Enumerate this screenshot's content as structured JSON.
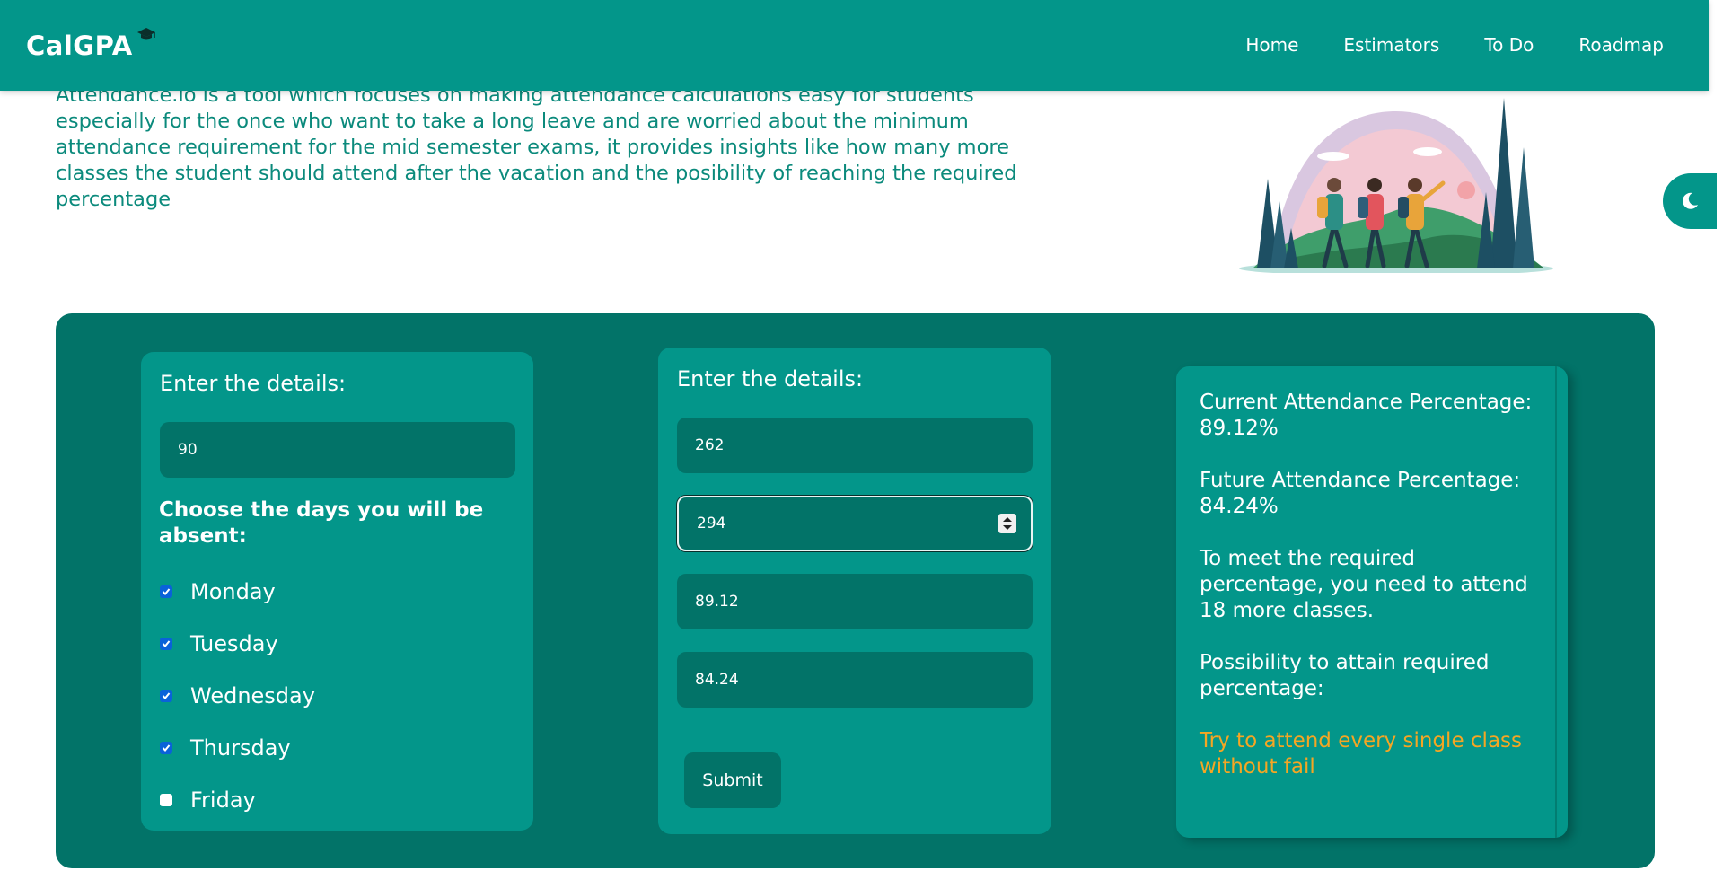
{
  "header": {
    "brand": "CalGPA",
    "nav": [
      {
        "label": "Home"
      },
      {
        "label": "Estimators"
      },
      {
        "label": "To Do"
      },
      {
        "label": "Roadmap"
      }
    ]
  },
  "intro": {
    "text": "Attendance.io is a tool which focuses on making attendance calculations easy for students especially for the once who want to take a long leave and are worried about the minimum attendance requirement for the mid semester exams, it provides insights like how many more classes the student should attend after the vacation and the posibility of reaching the required percentage"
  },
  "left_form": {
    "title": "Enter the details:",
    "input_value": "90",
    "absent_prompt": "Choose the days you will be absent:",
    "days": [
      {
        "label": "Monday",
        "checked": true
      },
      {
        "label": "Tuesday",
        "checked": true
      },
      {
        "label": "Wednesday",
        "checked": true
      },
      {
        "label": "Thursday",
        "checked": true
      },
      {
        "label": "Friday",
        "checked": false
      }
    ]
  },
  "middle_form": {
    "title": "Enter the details:",
    "fields": [
      {
        "value": "262"
      },
      {
        "value": "294"
      },
      {
        "value": "89.12"
      },
      {
        "value": "84.24"
      }
    ],
    "submit_label": "Submit"
  },
  "results": {
    "current": "Current Attendance Percentage: 89.12%",
    "future": "Future Attendance Percentage: 84.24%",
    "needed": "To meet the required percentage, you need to attend 18 more classes.",
    "possibility": "Possibility to attain required percentage:",
    "advice": "Try to attend every single class without fail"
  },
  "colors": {
    "primary": "#03968a",
    "panel": "#027368",
    "intro_text": "#0b8a7c",
    "advice": "#f5a623",
    "checkbox": "#0a62d9"
  },
  "icons": {
    "brand": "graduation-cap-icon",
    "theme": "moon-icon",
    "spinner": "number-spinner-icon",
    "checkmark": "checkmark-icon"
  }
}
